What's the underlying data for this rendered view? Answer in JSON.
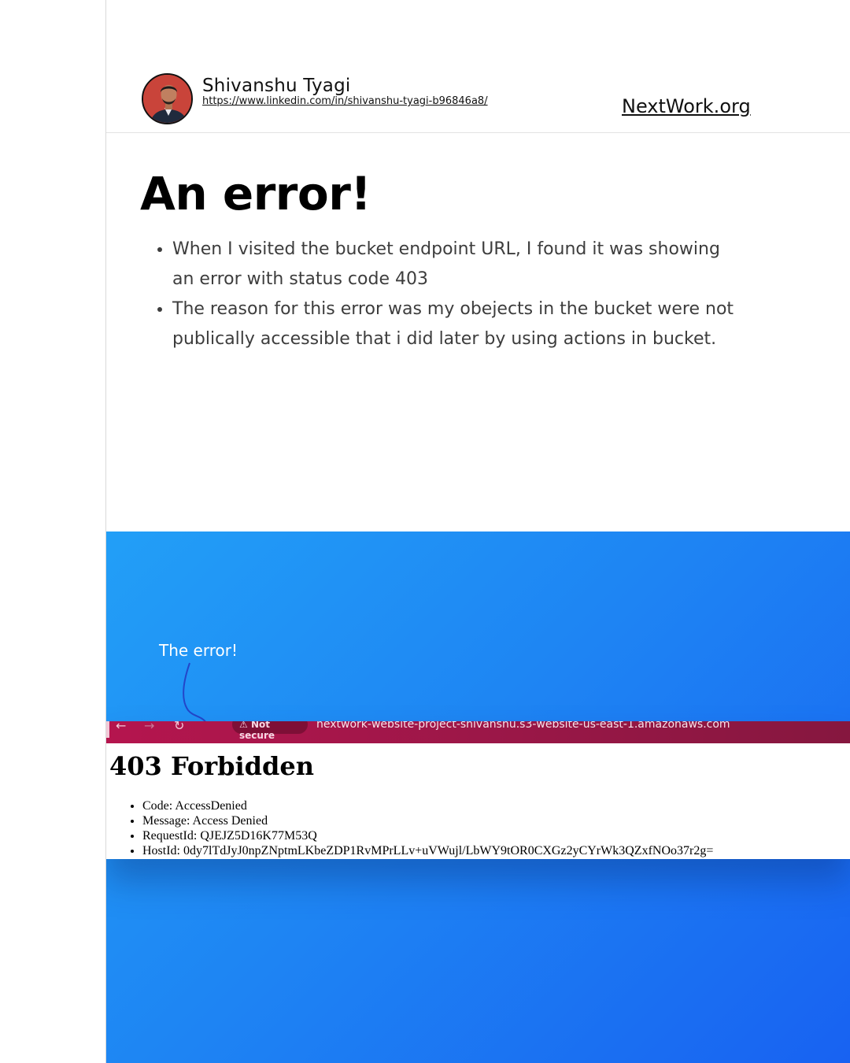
{
  "header": {
    "author_name": "Shivanshu Tyagi",
    "author_url": "https://www.linkedin.com/in/shivanshu-tyagi-b96846a8/",
    "brand": "NextWork.org"
  },
  "main": {
    "title": "An error!",
    "bullets": [
      "When I visited the bucket endpoint URL, I found it was showing an error with status code 403",
      "The reason for this error was my obejects in the bucket were not publically accessible that i did later by using actions in bucket."
    ]
  },
  "panel": {
    "caption": "The error!",
    "background_colors": [
      "#229ff7",
      "#1862f2"
    ],
    "browser": {
      "back_icon": "arrow-left-icon",
      "forward_icon": "arrow-right-icon",
      "reload_icon": "reload-icon",
      "security_label": "Not secure",
      "url": "nextwork-website-project-shivanshu.s3-website-us-east-1.amazonaws.com",
      "bar_color": "#a5164a"
    },
    "page": {
      "heading": "403 Forbidden",
      "items": [
        "Code: AccessDenied",
        "Message: Access Denied",
        "RequestId: QJEJZ5D16K77M53Q",
        "HostId: 0dy7lTdJyJ0npZNptmLKbeZDP1RvMPrLLv+uVWujl/LbWY9tOR0CXGz2yCYrWk3QZxfNOo37r2g="
      ]
    }
  }
}
